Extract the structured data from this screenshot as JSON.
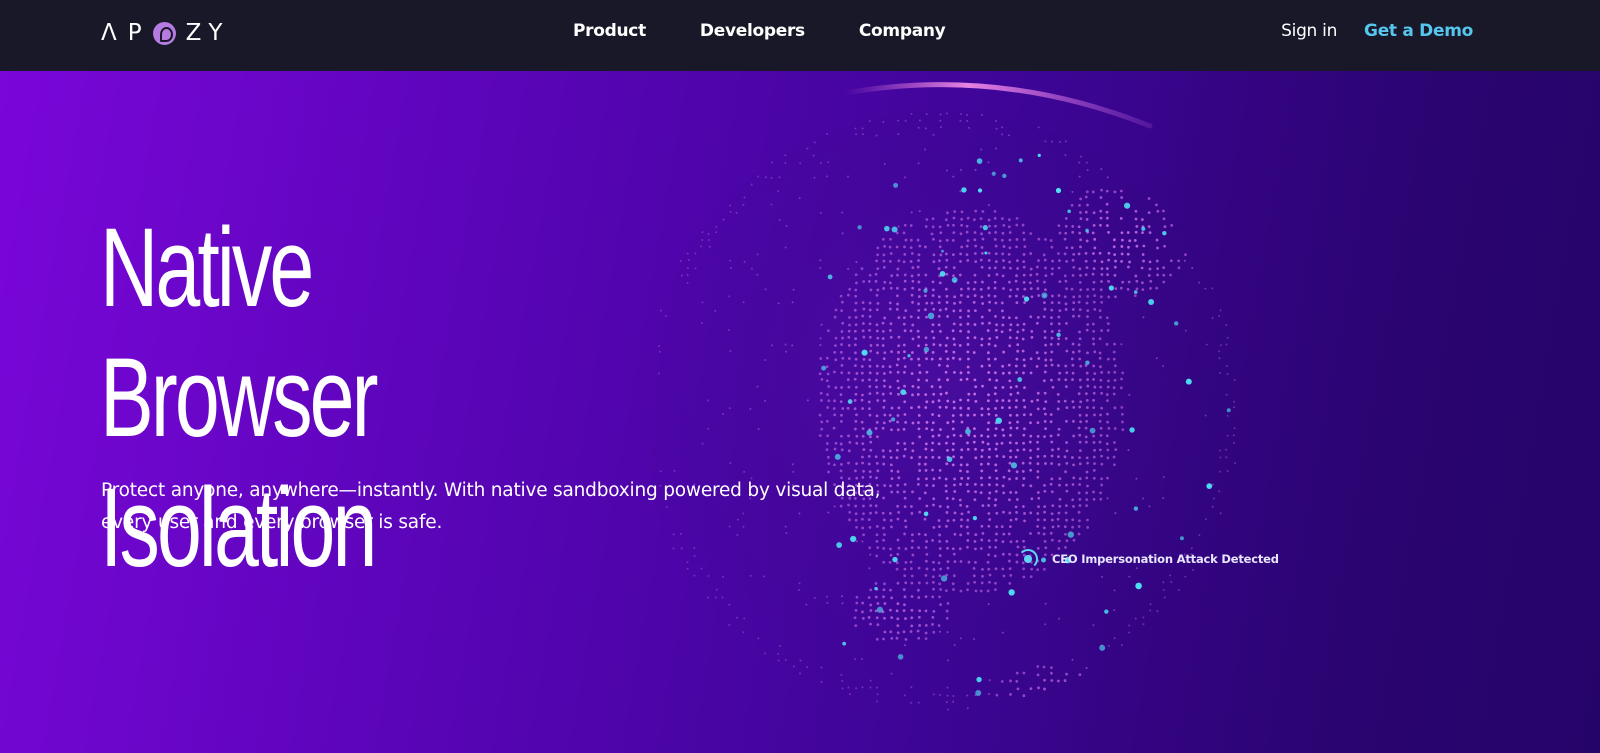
{
  "nav": {
    "logo_text": "APOZY",
    "links": [
      "Product",
      "Developers",
      "Company"
    ],
    "signin_label": "Sign in",
    "demo_label": "Get a Demo"
  },
  "hero": {
    "title_line1": "Native Browser",
    "title_line2": "Isolation",
    "subtitle_line1": "Protect anyone, anywhere—instantly. With native sandboxing powered by visual data,",
    "subtitle_line2": "every user and every browser is safe.",
    "alert_text": "CEO Impersonation Attack Detected"
  },
  "colors": {
    "nav_bg": "#181828",
    "accent": "#56c6ef",
    "hero_start": "#7a06d9",
    "hero_end": "#25046a",
    "dot_pink": "#c86fe8",
    "dot_cyan": "#4fe3f5"
  },
  "icons": {
    "logo_mark": "apozy-circle-glyph",
    "alert": "radar-ping-icon"
  }
}
